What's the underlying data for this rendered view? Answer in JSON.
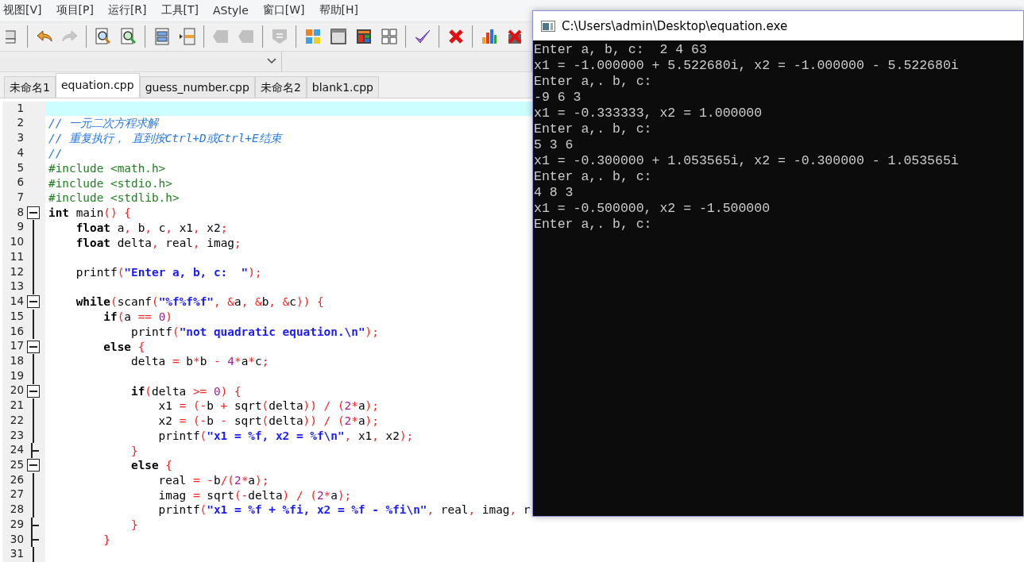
{
  "menu": [
    "视图[V]",
    "项目[P]",
    "运行[R]",
    "工具[T]",
    "AStyle",
    "窗口[W]",
    "帮助[H]"
  ],
  "toolbar": [
    [
      {
        "disabled": false
      }
    ],
    [
      {
        "disabled": false
      },
      {
        "disabled": true
      }
    ],
    [
      {
        "disabled": false
      },
      {
        "disabled": false
      }
    ],
    [
      {
        "disabled": false
      },
      {
        "disabled": false
      }
    ],
    [
      {
        "disabled": true
      },
      {
        "disabled": true
      }
    ],
    [
      {
        "disabled": true
      }
    ],
    [
      {
        "disabled": false
      },
      {
        "disabled": false
      },
      {
        "disabled": false
      },
      {
        "disabled": false
      }
    ],
    [
      {
        "disabled": false
      }
    ],
    [
      {
        "disabled": false
      }
    ],
    [
      {
        "disabled": false
      },
      {
        "disabled": false
      }
    ]
  ],
  "tabs": [
    {
      "label": "未命名1",
      "selected": false
    },
    {
      "label": "equation.cpp",
      "selected": true
    },
    {
      "label": "guess_number.cpp",
      "selected": false
    },
    {
      "label": "未命名2",
      "selected": false
    },
    {
      "label": "blank1.cpp",
      "selected": false
    }
  ],
  "editor": {
    "lines": [
      {
        "number": "1",
        "kind": "plain",
        "highlighted": true
      },
      {
        "number": "2",
        "kind": "plain",
        "highlighted": false,
        "tokens": [
          {
            "kind": "comment",
            "text": "// 一元二次方程求解"
          }
        ]
      },
      {
        "number": "3",
        "kind": "plain",
        "highlighted": false,
        "tokens": [
          {
            "kind": "comment",
            "text": "// 重复执行， 直到按Ctrl+D或Ctrl+E结束"
          }
        ]
      },
      {
        "number": "4",
        "kind": "plain",
        "highlighted": false,
        "tokens": [
          {
            "kind": "comment",
            "text": "//"
          }
        ]
      },
      {
        "number": "5",
        "kind": "plain",
        "highlighted": false,
        "tokens": [
          {
            "kind": "preprocessor",
            "text": "#include <math.h>"
          }
        ]
      },
      {
        "number": "6",
        "kind": "plain",
        "highlighted": false,
        "tokens": [
          {
            "kind": "preprocessor",
            "text": "#include <stdio.h>"
          }
        ]
      },
      {
        "number": "7",
        "kind": "plain",
        "highlighted": false,
        "tokens": [
          {
            "kind": "preprocessor",
            "text": "#include <stdlib.h>"
          }
        ]
      },
      {
        "number": "8",
        "kind": "fold-start",
        "highlighted": false,
        "tokens": [
          {
            "kind": "keyword",
            "text": "int"
          },
          {
            "kind": "plain",
            "text": " main"
          },
          {
            "kind": "operator",
            "text": "() {"
          }
        ]
      },
      {
        "number": "9",
        "kind": "plain",
        "highlighted": false,
        "tokens": [
          {
            "kind": "keyword",
            "text": "    float"
          },
          {
            "kind": "plain",
            "text": " a"
          },
          {
            "kind": "operator",
            "text": ","
          },
          {
            "kind": "plain",
            "text": " b"
          },
          {
            "kind": "operator",
            "text": ","
          },
          {
            "kind": "plain",
            "text": " c"
          },
          {
            "kind": "operator",
            "text": ","
          },
          {
            "kind": "plain",
            "text": " x1"
          },
          {
            "kind": "operator",
            "text": ","
          },
          {
            "kind": "plain",
            "text": " x2"
          },
          {
            "kind": "operator",
            "text": ";"
          }
        ]
      },
      {
        "number": "10",
        "kind": "plain",
        "highlighted": false,
        "tokens": [
          {
            "kind": "keyword",
            "text": "    float"
          },
          {
            "kind": "plain",
            "text": " delta"
          },
          {
            "kind": "operator",
            "text": ","
          },
          {
            "kind": "plain",
            "text": " real"
          },
          {
            "kind": "operator",
            "text": ","
          },
          {
            "kind": "plain",
            "text": " imag"
          },
          {
            "kind": "operator",
            "text": ";"
          }
        ]
      },
      {
        "number": "11",
        "kind": "plain",
        "highlighted": false
      },
      {
        "number": "12",
        "kind": "plain",
        "highlighted": false,
        "tokens": [
          {
            "kind": "plain",
            "text": "    printf"
          },
          {
            "kind": "operator",
            "text": "("
          },
          {
            "kind": "string",
            "text": "\"Enter a, b, c:  \""
          },
          {
            "kind": "operator",
            "text": ");"
          }
        ]
      },
      {
        "number": "13",
        "kind": "plain",
        "highlighted": false
      },
      {
        "number": "14",
        "kind": "fold-start",
        "highlighted": false,
        "tokens": [
          {
            "kind": "keyword",
            "text": "    while"
          },
          {
            "kind": "operator",
            "text": "("
          },
          {
            "kind": "plain",
            "text": "scanf"
          },
          {
            "kind": "operator",
            "text": "("
          },
          {
            "kind": "string",
            "text": "\"%f%f%f\""
          },
          {
            "kind": "operator",
            "text": ", &"
          },
          {
            "kind": "plain",
            "text": "a"
          },
          {
            "kind": "operator",
            "text": ", &"
          },
          {
            "kind": "plain",
            "text": "b"
          },
          {
            "kind": "operator",
            "text": ", &"
          },
          {
            "kind": "plain",
            "text": "c"
          },
          {
            "kind": "operator",
            "text": ")) {"
          }
        ]
      },
      {
        "number": "15",
        "kind": "plain",
        "highlighted": false,
        "tokens": [
          {
            "kind": "keyword",
            "text": "        if"
          },
          {
            "kind": "operator",
            "text": "("
          },
          {
            "kind": "plain",
            "text": "a "
          },
          {
            "kind": "operator",
            "text": "== "
          },
          {
            "kind": "number",
            "text": "0"
          },
          {
            "kind": "operator",
            "text": ")"
          }
        ]
      },
      {
        "number": "16",
        "kind": "plain",
        "highlighted": false,
        "tokens": [
          {
            "kind": "plain",
            "text": "            printf"
          },
          {
            "kind": "operator",
            "text": "("
          },
          {
            "kind": "string",
            "text": "\"not quadratic equation.\\n\""
          },
          {
            "kind": "operator",
            "text": ");"
          }
        ]
      },
      {
        "number": "17",
        "kind": "fold-start",
        "highlighted": false,
        "tokens": [
          {
            "kind": "keyword",
            "text": "        else"
          },
          {
            "kind": "operator",
            "text": " {"
          }
        ]
      },
      {
        "number": "18",
        "kind": "plain",
        "highlighted": false,
        "tokens": [
          {
            "kind": "plain",
            "text": "            delta "
          },
          {
            "kind": "operator",
            "text": "="
          },
          {
            "kind": "plain",
            "text": " b"
          },
          {
            "kind": "operator",
            "text": "*"
          },
          {
            "kind": "plain",
            "text": "b "
          },
          {
            "kind": "operator",
            "text": "- "
          },
          {
            "kind": "number",
            "text": "4"
          },
          {
            "kind": "operator",
            "text": "*"
          },
          {
            "kind": "plain",
            "text": "a"
          },
          {
            "kind": "operator",
            "text": "*"
          },
          {
            "kind": "plain",
            "text": "c"
          },
          {
            "kind": "operator",
            "text": ";"
          }
        ]
      },
      {
        "number": "19",
        "kind": "plain",
        "highlighted": false
      },
      {
        "number": "20",
        "kind": "fold-start",
        "highlighted": false,
        "tokens": [
          {
            "kind": "keyword",
            "text": "            if"
          },
          {
            "kind": "operator",
            "text": "("
          },
          {
            "kind": "plain",
            "text": "delta "
          },
          {
            "kind": "operator",
            "text": ">= "
          },
          {
            "kind": "number",
            "text": "0"
          },
          {
            "kind": "operator",
            "text": ") {"
          }
        ]
      },
      {
        "number": "21",
        "kind": "plain",
        "highlighted": false,
        "tokens": [
          {
            "kind": "plain",
            "text": "                x1 "
          },
          {
            "kind": "operator",
            "text": "= (-"
          },
          {
            "kind": "plain",
            "text": "b "
          },
          {
            "kind": "operator",
            "text": "+"
          },
          {
            "kind": "plain",
            "text": " sqrt"
          },
          {
            "kind": "operator",
            "text": "("
          },
          {
            "kind": "plain",
            "text": "delta"
          },
          {
            "kind": "operator",
            "text": ")) / ("
          },
          {
            "kind": "number",
            "text": "2"
          },
          {
            "kind": "operator",
            "text": "*"
          },
          {
            "kind": "plain",
            "text": "a"
          },
          {
            "kind": "operator",
            "text": ");"
          }
        ]
      },
      {
        "number": "22",
        "kind": "plain",
        "highlighted": false,
        "tokens": [
          {
            "kind": "plain",
            "text": "                x2 "
          },
          {
            "kind": "operator",
            "text": "= (-"
          },
          {
            "kind": "plain",
            "text": "b "
          },
          {
            "kind": "operator",
            "text": "-"
          },
          {
            "kind": "plain",
            "text": " sqrt"
          },
          {
            "kind": "operator",
            "text": "("
          },
          {
            "kind": "plain",
            "text": "delta"
          },
          {
            "kind": "operator",
            "text": ")) / ("
          },
          {
            "kind": "number",
            "text": "2"
          },
          {
            "kind": "operator",
            "text": "*"
          },
          {
            "kind": "plain",
            "text": "a"
          },
          {
            "kind": "operator",
            "text": ");"
          }
        ]
      },
      {
        "number": "23",
        "kind": "plain",
        "highlighted": false,
        "tokens": [
          {
            "kind": "plain",
            "text": "                printf"
          },
          {
            "kind": "operator",
            "text": "("
          },
          {
            "kind": "string",
            "text": "\"x1 = %f, x2 = %f\\n\""
          },
          {
            "kind": "operator",
            "text": ","
          },
          {
            "kind": "plain",
            "text": " x1"
          },
          {
            "kind": "operator",
            "text": ","
          },
          {
            "kind": "plain",
            "text": " x2"
          },
          {
            "kind": "operator",
            "text": ");"
          }
        ]
      },
      {
        "number": "24",
        "kind": "fold-end",
        "highlighted": false,
        "tokens": [
          {
            "kind": "operator",
            "text": "            }"
          }
        ]
      },
      {
        "number": "25",
        "kind": "fold-start",
        "highlighted": false,
        "tokens": [
          {
            "kind": "keyword",
            "text": "            else"
          },
          {
            "kind": "operator",
            "text": " {"
          }
        ]
      },
      {
        "number": "26",
        "kind": "plain",
        "highlighted": false,
        "tokens": [
          {
            "kind": "plain",
            "text": "                real "
          },
          {
            "kind": "operator",
            "text": "= -"
          },
          {
            "kind": "plain",
            "text": "b"
          },
          {
            "kind": "operator",
            "text": "/("
          },
          {
            "kind": "number",
            "text": "2"
          },
          {
            "kind": "operator",
            "text": "*"
          },
          {
            "kind": "plain",
            "text": "a"
          },
          {
            "kind": "operator",
            "text": ");"
          }
        ]
      },
      {
        "number": "27",
        "kind": "plain",
        "highlighted": false,
        "tokens": [
          {
            "kind": "plain",
            "text": "                imag "
          },
          {
            "kind": "operator",
            "text": "="
          },
          {
            "kind": "plain",
            "text": " sqrt"
          },
          {
            "kind": "operator",
            "text": "(-"
          },
          {
            "kind": "plain",
            "text": "delta"
          },
          {
            "kind": "operator",
            "text": ") / ("
          },
          {
            "kind": "number",
            "text": "2"
          },
          {
            "kind": "operator",
            "text": "*"
          },
          {
            "kind": "plain",
            "text": "a"
          },
          {
            "kind": "operator",
            "text": ");"
          }
        ]
      },
      {
        "number": "28",
        "kind": "plain",
        "highlighted": false,
        "tokens": [
          {
            "kind": "plain",
            "text": "                printf"
          },
          {
            "kind": "operator",
            "text": "("
          },
          {
            "kind": "string",
            "text": "\"x1 = %f + %fi, x2 = %f - %fi\\n\""
          },
          {
            "kind": "operator",
            "text": ","
          },
          {
            "kind": "plain",
            "text": " real"
          },
          {
            "kind": "operator",
            "text": ","
          },
          {
            "kind": "plain",
            "text": " imag"
          },
          {
            "kind": "operator",
            "text": ","
          },
          {
            "kind": "plain",
            "text": " r"
          }
        ]
      },
      {
        "number": "29",
        "kind": "fold-end",
        "highlighted": false,
        "tokens": [
          {
            "kind": "operator",
            "text": "            }"
          }
        ]
      },
      {
        "number": "30",
        "kind": "fold-end",
        "highlighted": false,
        "tokens": [
          {
            "kind": "operator",
            "text": "        }"
          }
        ]
      },
      {
        "number": "31",
        "kind": "plain",
        "highlighted": false
      }
    ]
  },
  "console": {
    "title": "C:\\Users\\admin\\Desktop\\equation.exe",
    "lines": [
      "Enter a, b, c:  2 4 63",
      "x1 = -1.000000 + 5.522680i, x2 = -1.000000 - 5.522680i",
      "Enter a,. b, c:",
      "-9 6 3",
      "x1 = -0.333333, x2 = 1.000000",
      "Enter a,. b, c:",
      "5 3 6",
      "x1 = -0.300000 + 1.053565i, x2 = -0.300000 - 1.053565i",
      "Enter a,. b, c:",
      "4 8 3",
      "x1 = -0.500000, x2 = -1.500000",
      "Enter a,. b, c:"
    ]
  }
}
